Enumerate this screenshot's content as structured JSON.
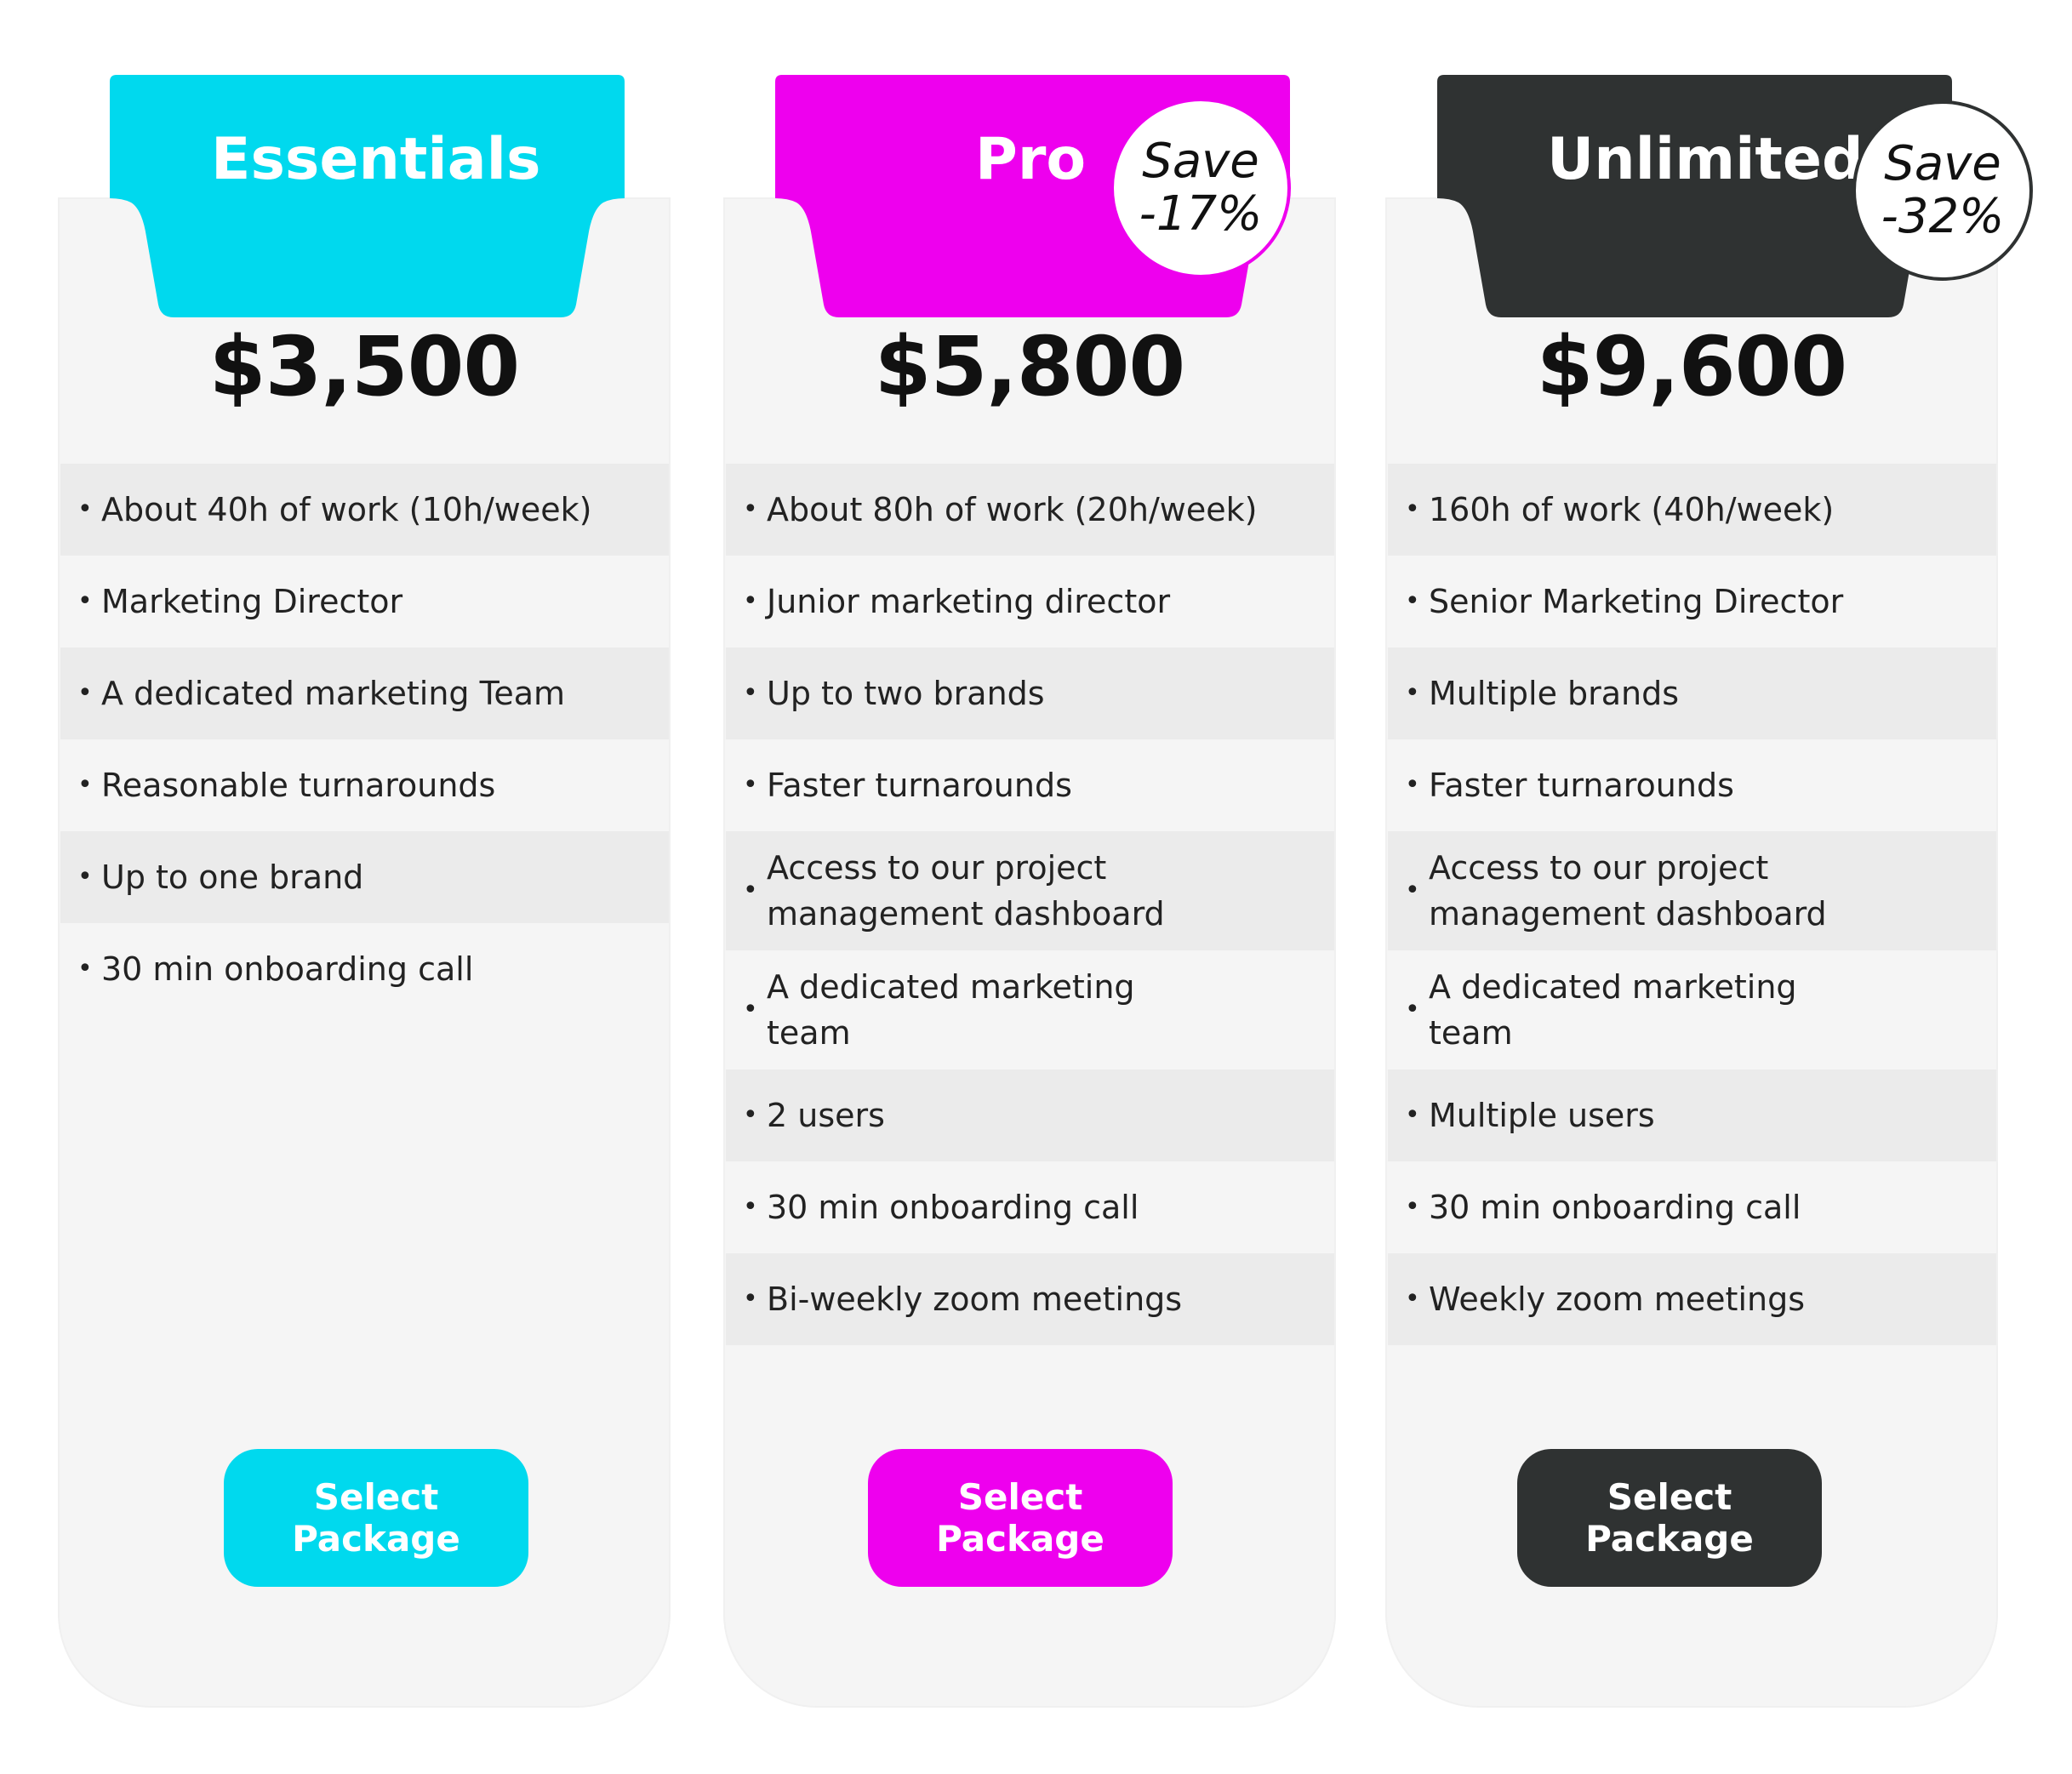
{
  "plans": [
    {
      "name": "Essentials",
      "color": "#00d9ee",
      "btn_text_color": "#ffffff",
      "price": "$3,500",
      "save": null,
      "features": [
        "About 40h of work (10h/week)",
        "Marketing Director",
        "A dedicated marketing Team",
        "Reasonable turnarounds",
        "Up to one brand",
        "30 min onboarding call"
      ],
      "button_label": "Select Package"
    },
    {
      "name": "Pro",
      "color": "#ee00ee",
      "btn_text_color": "#ffffff",
      "price": "$5,800",
      "save": {
        "line1": "Save",
        "line2": "-17%"
      },
      "features": [
        "About 80h of work (20h/week)",
        "Junior marketing director",
        "Up to two brands",
        "Faster turnarounds",
        "Access to our project management dashboard",
        "A dedicated marketing team",
        "2 users",
        "30 min onboarding call",
        "Bi-weekly zoom meetings"
      ],
      "button_label": "Select Package"
    },
    {
      "name": "Unlimited",
      "color": "#2f3232",
      "btn_text_color": "#ffffff",
      "price": "$9,600",
      "save": {
        "line1": "Save",
        "line2": "-32%"
      },
      "features": [
        "160h of work (40h/week)",
        "Senior Marketing Director",
        "Multiple brands",
        "Faster turnarounds",
        "Access to our project management  dashboard",
        "A dedicated marketing team",
        "Multiple users",
        "30 min onboarding call",
        "Weekly zoom meetings"
      ],
      "button_label": "Select Package"
    }
  ],
  "bullet_char": "•"
}
